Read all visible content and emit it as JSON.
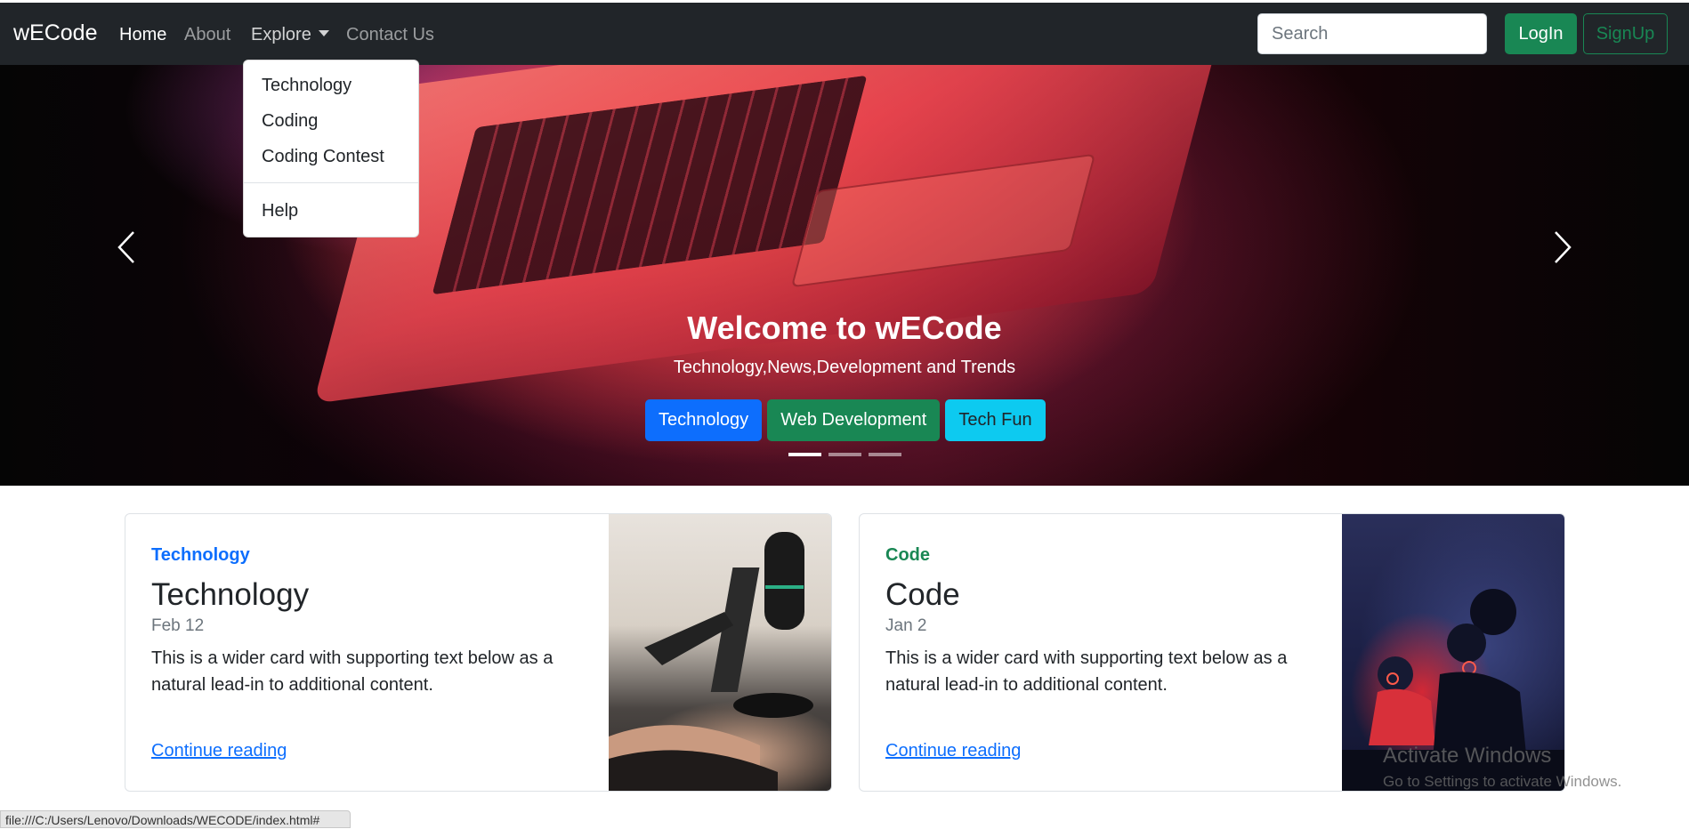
{
  "navbar": {
    "brand": "wECode",
    "links": [
      {
        "label": "Home",
        "active": true
      },
      {
        "label": "About",
        "active": false
      },
      {
        "label": "Explore",
        "active": false
      },
      {
        "label": "Contact Us",
        "active": false
      }
    ],
    "search_placeholder": "Search",
    "login_label": "LogIn",
    "signup_label": "SignUp"
  },
  "dropdown": {
    "items": [
      "Technology",
      "Coding",
      "Coding Contest"
    ],
    "help": "Help"
  },
  "hero": {
    "title": "Welcome to wECode",
    "subtitle": "Technology,News,Development and Trends",
    "buttons": [
      {
        "label": "Technology",
        "color": "#0d6efd",
        "text_color": "#ffffff"
      },
      {
        "label": "Web Development",
        "color": "#198754",
        "text_color": "#ffffff"
      },
      {
        "label": "Tech Fun",
        "color": "#0dcaf0",
        "text_color": "#212529"
      }
    ],
    "active_slide": 1,
    "slide_count": 3,
    "prev_icon": "chevron-left-icon",
    "next_icon": "chevron-right-icon"
  },
  "cards": [
    {
      "tag": "Technology",
      "tag_color": "#0d6efd",
      "title": "Technology",
      "date": "Feb 12",
      "text": "This is a wider card with supporting text below as a natural lead-in to additional content.",
      "link": "Continue reading"
    },
    {
      "tag": "Code",
      "tag_color": "#198754",
      "title": "Code",
      "date": "Jan 2",
      "text": "This is a wider card with supporting text below as a natural lead-in to additional content.",
      "link": "Continue reading"
    }
  ],
  "watermark": {
    "line1": "Activate Windows",
    "line2": "Go to Settings to activate Windows."
  },
  "status_url": "file:///C:/Users/Lenovo/Downloads/WECODE/index.html#",
  "colors": {
    "navbar_bg": "#212529",
    "success": "#198754",
    "primary": "#0d6efd",
    "info": "#0dcaf0"
  }
}
